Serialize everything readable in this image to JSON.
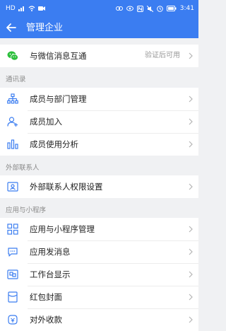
{
  "status_bar": {
    "network": "HD",
    "time": "3:41"
  },
  "appbar": {
    "title": "管理企业"
  },
  "wechat_row": {
    "label": "与微信消息互通",
    "value": "验证后可用"
  },
  "sections": [
    {
      "title": "通讯录",
      "items": [
        {
          "label": "成员与部门管理",
          "icon": "org-chart-icon"
        },
        {
          "label": "成员加入",
          "icon": "add-user-icon"
        },
        {
          "label": "成员使用分析",
          "icon": "bar-chart-icon"
        }
      ]
    },
    {
      "title": "外部联系人",
      "items": [
        {
          "label": "外部联系人权限设置",
          "icon": "contact-card-icon"
        }
      ]
    },
    {
      "title": "应用与小程序",
      "items": [
        {
          "label": "应用与小程序管理",
          "icon": "apps-grid-icon"
        },
        {
          "label": "应用发消息",
          "icon": "message-icon"
        },
        {
          "label": "工作台显示",
          "icon": "workbench-icon"
        },
        {
          "label": "红包封面",
          "icon": "red-envelope-icon"
        },
        {
          "label": "对外收款",
          "icon": "payment-icon"
        }
      ]
    }
  ],
  "colors": {
    "accent": "#3b7df1",
    "wechat_green": "#2bbf3b",
    "icon_blue": "#3b7df1"
  }
}
